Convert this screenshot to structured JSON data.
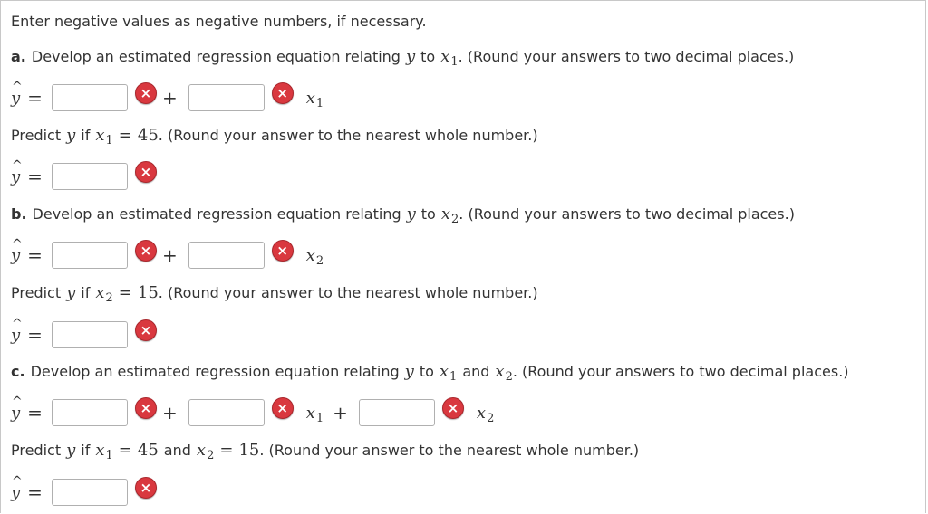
{
  "intro": "Enter negative values as negative numbers, if necessary.",
  "common": {
    "y": "y",
    "yhat": "y",
    "x": "x",
    "eq": "=",
    "plus": "+",
    "x_icon": "×"
  },
  "a": {
    "letter": "a.",
    "text_pre": "Develop an estimated regression equation relating",
    "to": "to",
    "sub1": "1",
    "text_post": ". (Round your answers to two decimal places.)",
    "predict_pre": "Predict",
    "if": "if",
    "value": "45",
    "predict_post": ". (Round your answer to the nearest whole number.)"
  },
  "b": {
    "letter": "b.",
    "text_pre": "Develop an estimated regression equation relating",
    "to": "to",
    "sub2": "2",
    "text_post": ". (Round your answers to two decimal places.)",
    "predict_pre": "Predict",
    "if": "if",
    "value": "15",
    "predict_post": ". (Round your answer to the nearest whole number.)"
  },
  "c": {
    "letter": "c.",
    "text_pre": "Develop an estimated regression equation relating",
    "to": "to",
    "and": "and",
    "sub1": "1",
    "sub2": "2",
    "text_post": ". (Round your answers to two decimal places.)",
    "predict_pre": "Predict",
    "if": "if",
    "value1": "45",
    "value2": "15",
    "predict_post": ". (Round your answer to the nearest whole number.)"
  },
  "inputs": {
    "a_intercept": "",
    "a_slope": "",
    "a_predict": "",
    "b_intercept": "",
    "b_slope": "",
    "b_predict": "",
    "c_intercept": "",
    "c_slope1": "",
    "c_slope2": "",
    "c_predict": ""
  }
}
